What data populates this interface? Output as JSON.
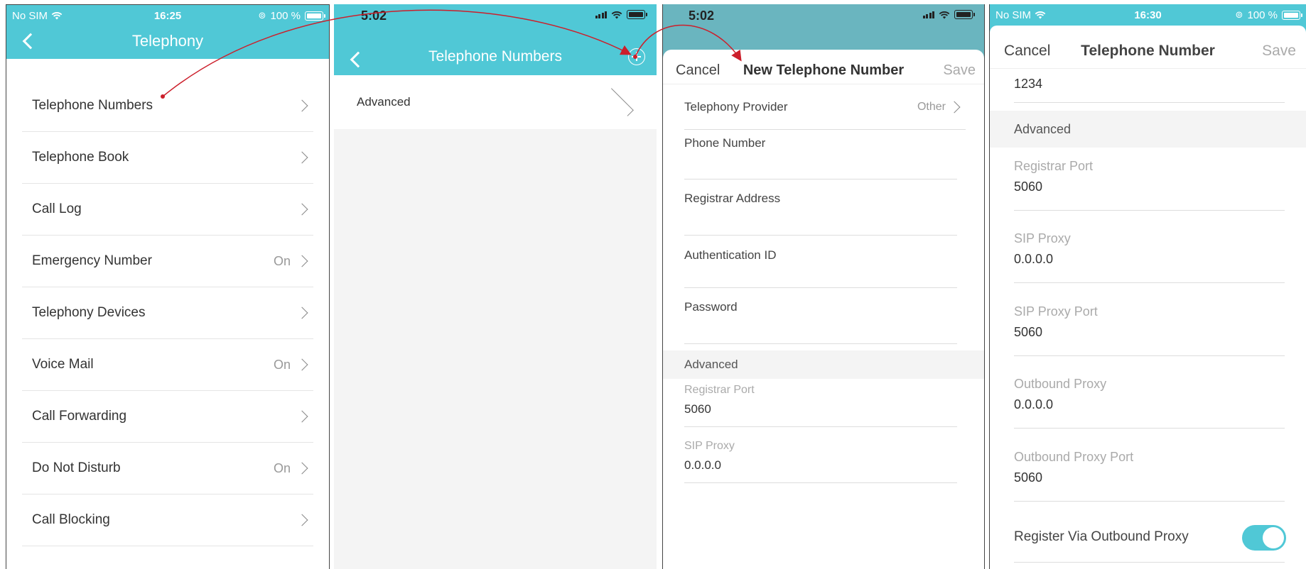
{
  "p1": {
    "status": {
      "carrier": "No SIM",
      "time": "16:25",
      "battery": "100 %"
    },
    "title": "Telephony",
    "items": [
      {
        "label": "Telephone Numbers",
        "value": ""
      },
      {
        "label": "Telephone Book",
        "value": ""
      },
      {
        "label": "Call Log",
        "value": ""
      },
      {
        "label": "Emergency Number",
        "value": "On"
      },
      {
        "label": "Telephony Devices",
        "value": ""
      },
      {
        "label": "Voice Mail",
        "value": "On"
      },
      {
        "label": "Call Forwarding",
        "value": ""
      },
      {
        "label": "Do Not Disturb",
        "value": "On"
      },
      {
        "label": "Call Blocking",
        "value": ""
      }
    ]
  },
  "p2": {
    "time": "5:02",
    "title": "Telephone Numbers",
    "advanced": "Advanced"
  },
  "p3": {
    "time": "5:02",
    "cancel": "Cancel",
    "title": "New Telephone Number",
    "save": "Save",
    "provider_label": "Telephony Provider",
    "provider_value": "Other",
    "phone_label": "Phone Number",
    "registrar_label": "Registrar Address",
    "auth_label": "Authentication ID",
    "password_label": "Password",
    "advanced": "Advanced",
    "reg_port_label": "Registrar Port",
    "reg_port_value": "5060",
    "sip_proxy_label": "SIP Proxy",
    "sip_proxy_value": "0.0.0.0"
  },
  "p4": {
    "status": {
      "carrier": "No SIM",
      "time": "16:30",
      "battery": "100 %"
    },
    "cancel": "Cancel",
    "title": "Telephone Number",
    "save": "Save",
    "top_value": "1234",
    "advanced": "Advanced",
    "fields": [
      {
        "label": "Registrar Port",
        "value": "5060"
      },
      {
        "label": "SIP Proxy",
        "value": "0.0.0.0"
      },
      {
        "label": "SIP Proxy Port",
        "value": "5060"
      },
      {
        "label": "Outbound Proxy",
        "value": "0.0.0.0"
      },
      {
        "label": "Outbound Proxy Port",
        "value": "5060"
      }
    ],
    "toggle_label": "Register Via Outbound Proxy",
    "toggle_on": true
  },
  "colors": {
    "accent": "#50c8d6",
    "arrow": "#cc1f2b"
  }
}
